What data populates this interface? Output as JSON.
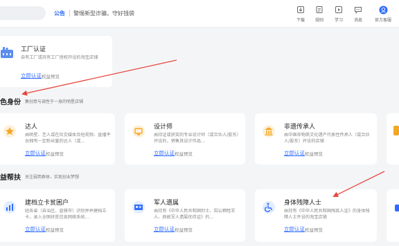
{
  "topbar": {
    "notice_tag": "公告",
    "notice_text": "警惕新型诈骗，守好钱袋",
    "nav": [
      {
        "label": "下载",
        "icon": "download-icon"
      },
      {
        "label": "规则",
        "icon": "rules-icon"
      },
      {
        "label": "学习",
        "icon": "learn-icon"
      },
      {
        "label": "消息",
        "icon": "message-icon"
      },
      {
        "label": "官方客服",
        "icon": "customer-service-icon"
      }
    ]
  },
  "factory": {
    "title": "工厂认证",
    "desc": "自有工厂或持有工厂授权开设的淘宝店铺",
    "apply": "立即认证",
    "rights": "权益预览"
  },
  "section_identity": {
    "title": "色身份",
    "subtitle": "集创意与调性于一身的明星店铺",
    "cards": [
      {
        "title": "达人",
        "desc": "由明星、艺人或在社交媒体及短视频、直播平台拥有一定粉丝量的达人（或…",
        "apply": "立即认证",
        "rights": "权益预览"
      },
      {
        "title": "设计师",
        "desc": "由持证或获奖的专业设计师（或合伙人/股东）开设的，销售其设计作品…",
        "apply": "立即认证",
        "rights": "权益预览"
      },
      {
        "title": "非遗传承人",
        "desc": "由中国非物质文化遗产代表性传承人（或合伙人/股东）开设的店铺",
        "apply": "立即认证",
        "rights": "权益预览"
      }
    ]
  },
  "section_support": {
    "title": "益帮扶",
    "subtitle": "关注弱势群体，实现创业梦想",
    "cards": [
      {
        "title": "建档立卡贫困户",
        "desc": "经各省（自治区、直辖市）识别并并建档立卡，录入全国扶贫信息网络系统…",
        "apply": "立即认证",
        "rights": "权益预览"
      },
      {
        "title": "军人遗属",
        "desc": "由持有《中华人民共和国烈士、因公牺牲军人、病故军人遗属优待证》的…",
        "apply": "立即认证",
        "rights": "权益预览"
      },
      {
        "title": "身体残障人士",
        "desc": "由持有《中华人民共和国残疾人证》的身体残障人士开设的淘宝店铺",
        "apply": "立即认证",
        "rights": "权益预览"
      }
    ]
  },
  "colors": {
    "accent": "#2f6bff",
    "arrow": "#e8453c",
    "icon_yellow": "#f5a623"
  }
}
